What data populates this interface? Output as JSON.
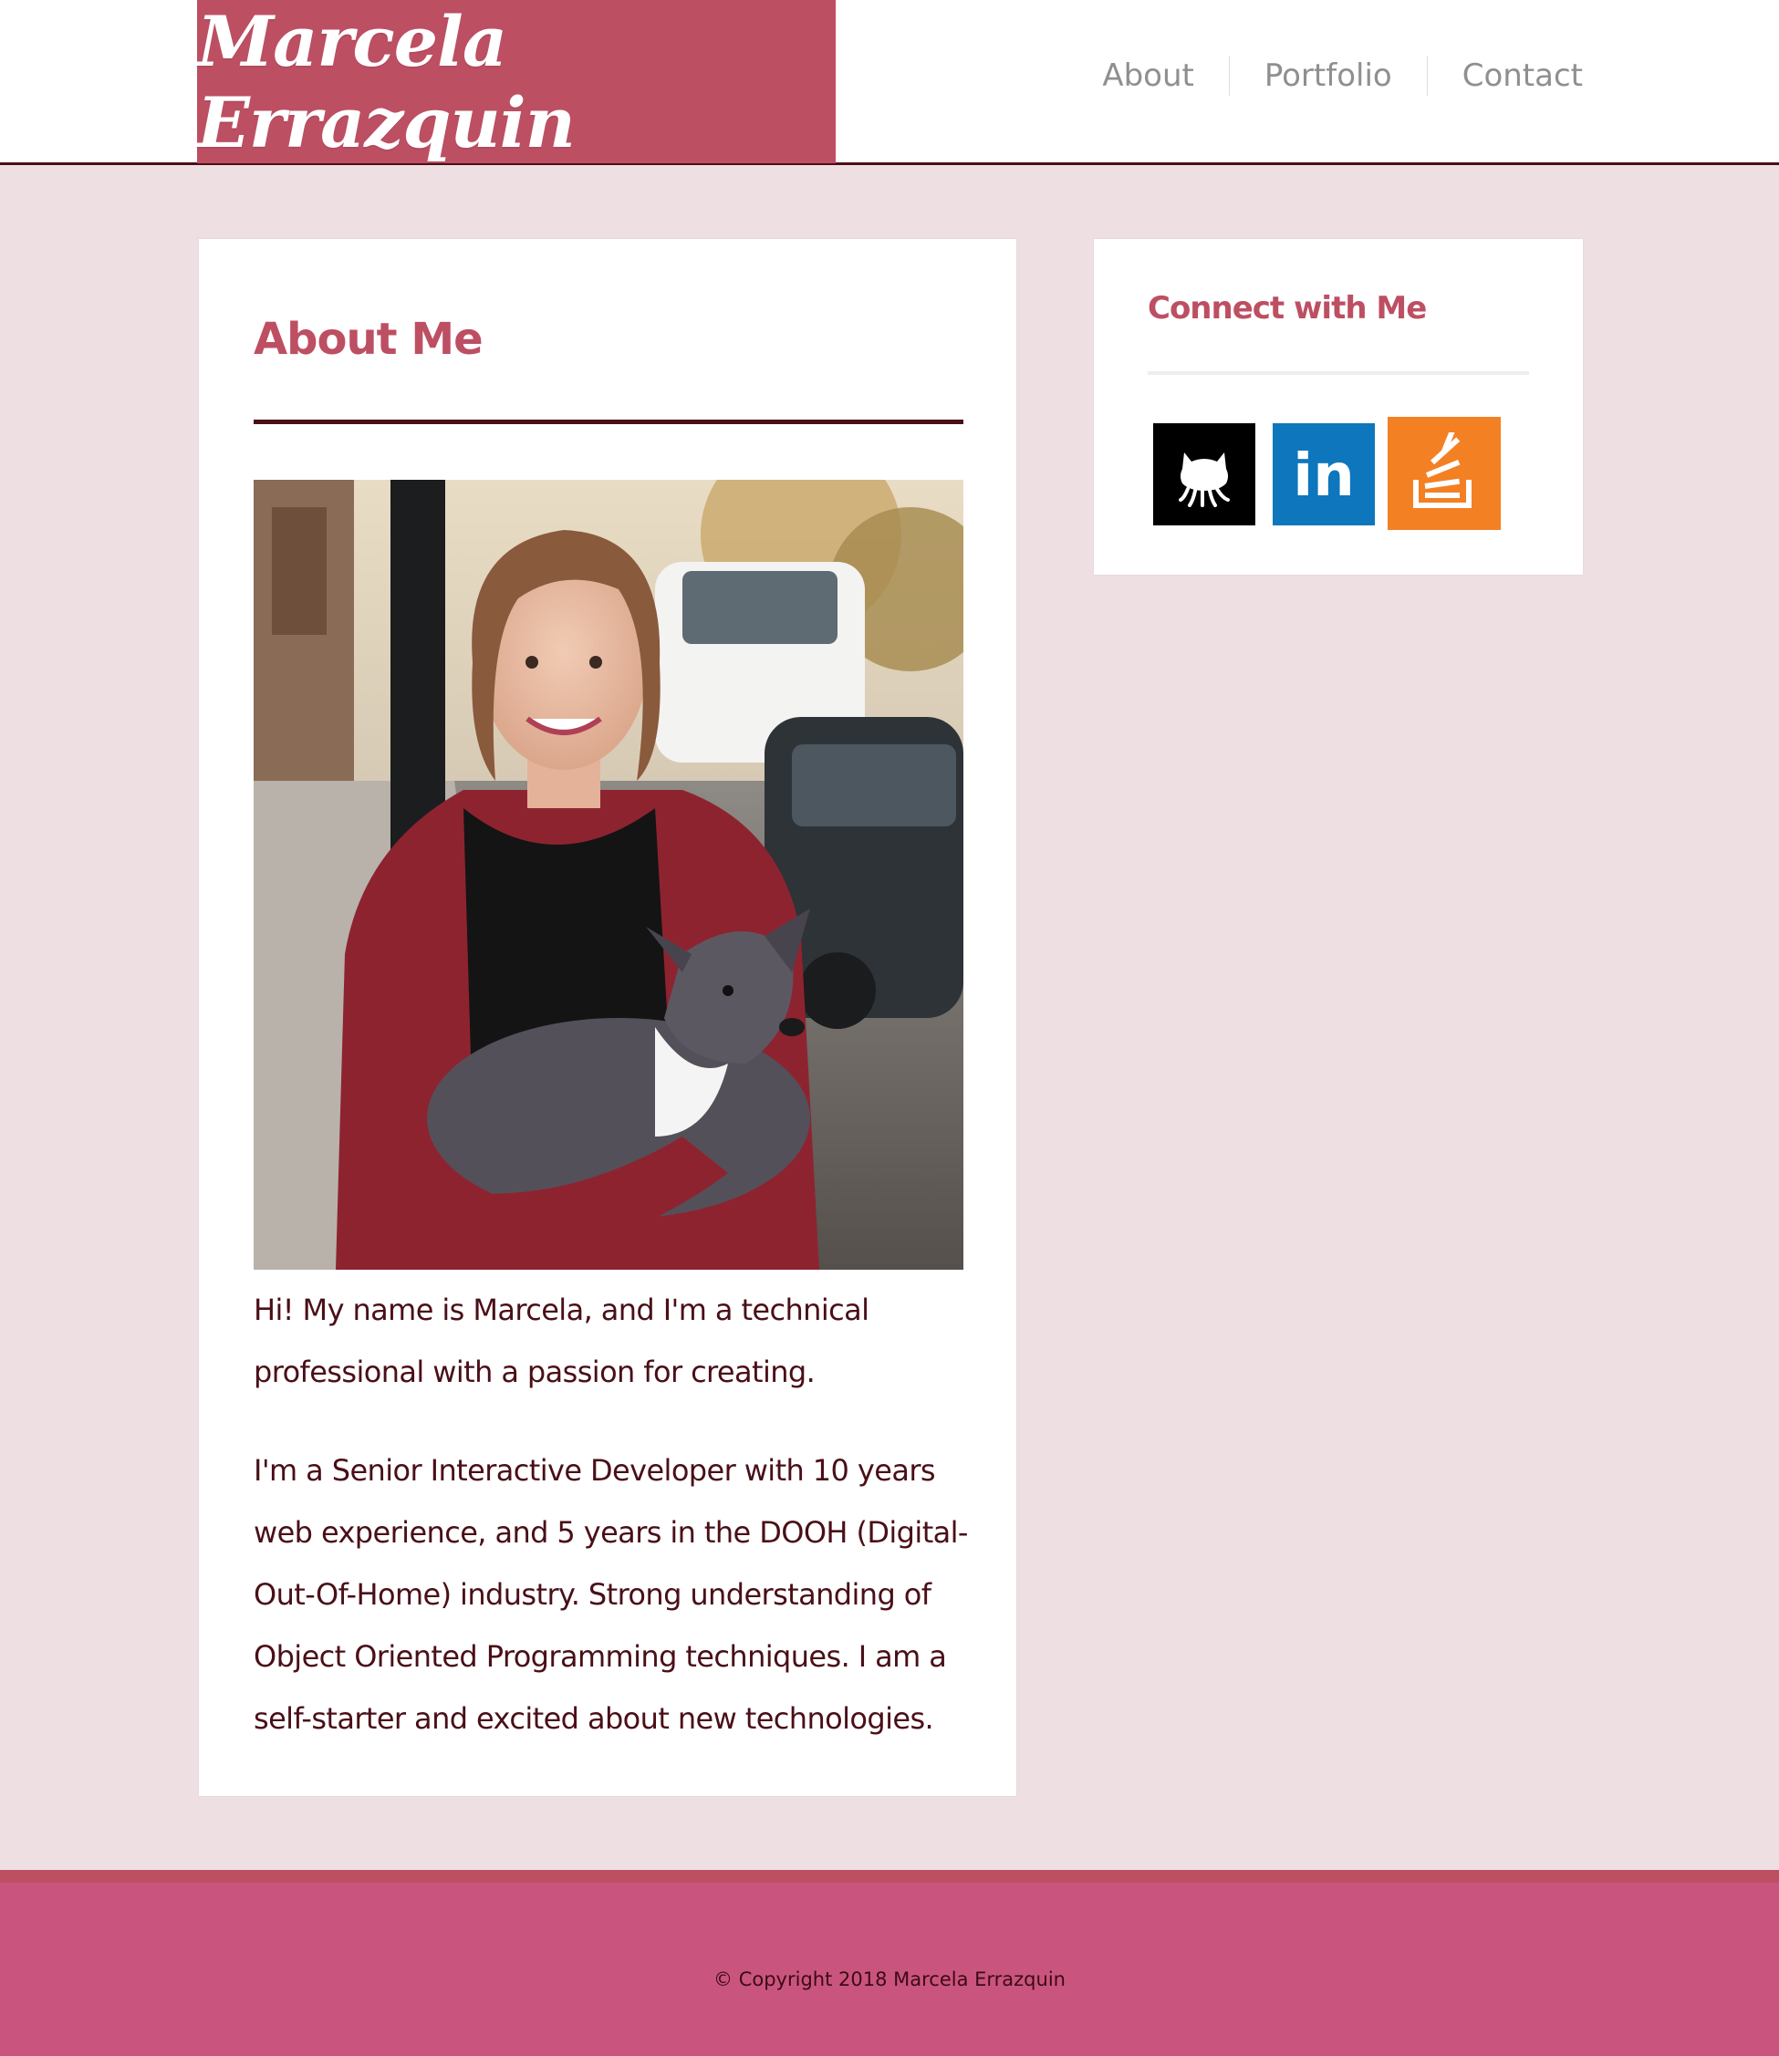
{
  "header": {
    "brand": "Marcela Errazquin",
    "nav": [
      {
        "label": "About"
      },
      {
        "label": "Portfolio"
      },
      {
        "label": "Contact"
      }
    ]
  },
  "about": {
    "title": "About Me",
    "photo_alt": "Marcela Errazquin holding her dog",
    "paragraphs": [
      "Hi! My name is Marcela, and I'm a technical professional with a passion for creating.",
      "I'm a Senior Interactive Developer with 10 years web experience, and 5 years in the DOOH (Digital-Out-Of-Home) industry. Strong understanding of Object Oriented Programming techniques. I am a self-starter and excited about new technologies."
    ]
  },
  "sidebar": {
    "title": "Connect with Me",
    "links": [
      {
        "name": "GitHub",
        "icon": "github-icon",
        "color": "#000000"
      },
      {
        "name": "LinkedIn",
        "icon": "linkedin-icon",
        "color": "#0e76bc",
        "glyph": "in"
      },
      {
        "name": "Stack Overflow",
        "icon": "stackoverflow-icon",
        "color": "#f48024"
      }
    ]
  },
  "footer": {
    "copyright": "© Copyright 2018 Marcela Errazquin"
  },
  "colors": {
    "brand": "#bd4f63",
    "dark": "#4a0f17",
    "background": "#eee0e2",
    "footer": "#c9557e"
  }
}
